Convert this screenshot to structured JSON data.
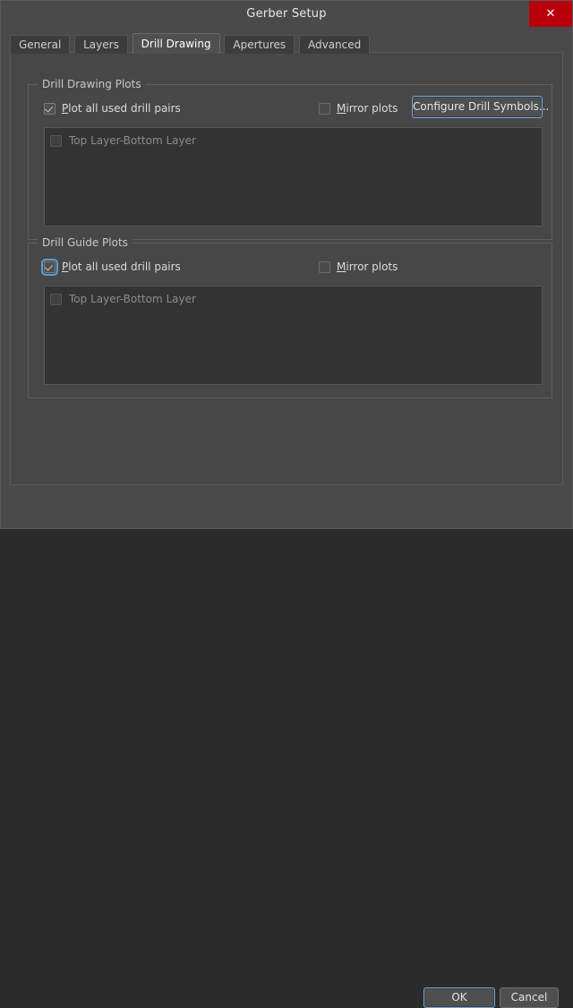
{
  "window": {
    "title": "Gerber Setup",
    "close_icon": "close-icon",
    "close_label": "✕"
  },
  "tabs": [
    {
      "label": "General",
      "active": false
    },
    {
      "label": "Layers",
      "active": false
    },
    {
      "label": "Drill Drawing",
      "active": true
    },
    {
      "label": "Apertures",
      "active": false
    },
    {
      "label": "Advanced",
      "active": false
    }
  ],
  "drill_drawing_plots": {
    "group_title": "Drill Drawing Plots",
    "plot_all": {
      "label_accel": "P",
      "label_rest": "lot all used drill pairs",
      "checked": true,
      "focused": false
    },
    "mirror": {
      "label_accel": "M",
      "label_rest": "irror plots",
      "checked": false,
      "focused": false
    },
    "configure_button": "Configure Drill Symbols...",
    "list_items": [
      {
        "label": "Top Layer-Bottom Layer",
        "checked": false,
        "enabled": false
      }
    ]
  },
  "drill_guide_plots": {
    "group_title": "Drill Guide Plots",
    "plot_all": {
      "label_accel": "P",
      "label_rest": "lot all used drill pairs",
      "checked": true,
      "focused": true
    },
    "mirror": {
      "label_accel": "M",
      "label_rest": "irror plots",
      "checked": false,
      "focused": false
    },
    "list_items": [
      {
        "label": "Top Layer-Bottom Layer",
        "checked": false,
        "enabled": false
      }
    ]
  },
  "footer": {
    "ok_label": "OK",
    "cancel_label": "Cancel"
  },
  "colors": {
    "accent_focus": "#6fa8dc",
    "close_red": "#b8000b",
    "panel": "#474747",
    "window": "#4a4a4a",
    "listbox": "#333333"
  }
}
